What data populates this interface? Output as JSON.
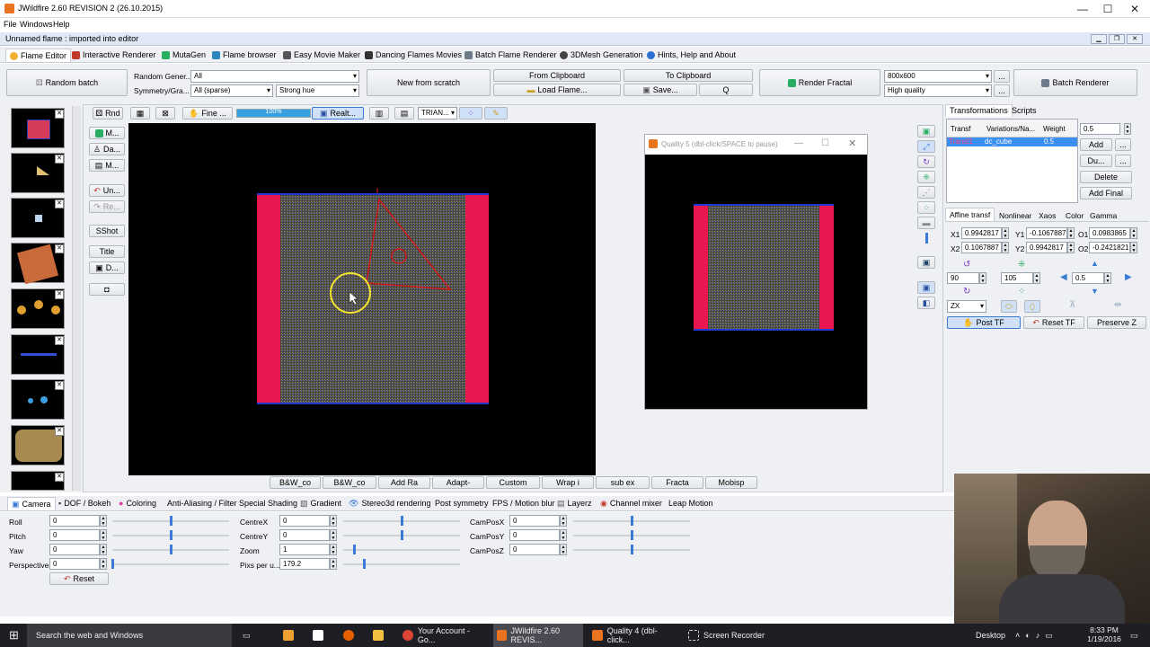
{
  "window": {
    "title": "JWildfire 2.60 REVISION 2 (26.10.2015)"
  },
  "menu": {
    "file": "File",
    "windows": "Windows",
    "help": "Help"
  },
  "inner": {
    "title": "Unnamed flame : imported into editor"
  },
  "tabs": [
    {
      "label": "Flame Editor",
      "icon": "flame-icon"
    },
    {
      "label": "Interactive Renderer",
      "icon": "renderer-icon"
    },
    {
      "label": "MutaGen",
      "icon": "mutagen-icon"
    },
    {
      "label": "Flame browser",
      "icon": "browser-icon"
    },
    {
      "label": "Easy Movie Maker",
      "icon": "movie-icon"
    },
    {
      "label": "Dancing Flames Movies",
      "icon": "dance-icon"
    },
    {
      "label": "Batch Flame Renderer",
      "icon": "batch-icon"
    },
    {
      "label": "3DMesh Generation",
      "icon": "mesh-icon"
    },
    {
      "label": "Hints, Help and About",
      "icon": "help-icon"
    }
  ],
  "toolbar": {
    "random_batch": "Random batch",
    "random_gen_label": "Random Gener...",
    "random_gen_value": "All",
    "symmetry_label": "Symmetry/Gra...",
    "symmetry_value": "All (sparse)",
    "gradient_value": "Strong hue",
    "new_from_scratch": "New from scratch",
    "from_clipboard": "From Clipboard",
    "to_clipboard": "To Clipboard",
    "load_flame": "Load Flame...",
    "save": "Save...",
    "q": "Q",
    "render_fractal": "Render Fractal",
    "resolution": "800x600",
    "quality": "High quality",
    "more": "...",
    "batch_renderer": "Batch Renderer"
  },
  "editor_toolbar": {
    "rnd": "Rnd",
    "fine": "Fine ...",
    "progress": "100%",
    "progress_value": 1.0,
    "realtime": "Realt...",
    "trian": "TRIAN..."
  },
  "side_buttons": [
    "M...",
    "Da...",
    "M...",
    "Un...",
    "Re...",
    "SShot",
    "Title",
    "D..."
  ],
  "bottom_buttons": [
    "B&W_co",
    "B&W_co",
    "Add Ra",
    "Adapt-",
    "Custom",
    "Wrap i",
    "sub ex",
    "Fracta",
    "Mobisp"
  ],
  "preview_window": {
    "title": "Quality 5 (dbl-click/SPACE to pause)"
  },
  "right_panel": {
    "tabs": [
      "Transformations",
      "Scripts"
    ],
    "table_headers": [
      "Transf",
      "Variations/Na...",
      "Weight"
    ],
    "row": {
      "transf": "Transf1",
      "variation": "dc_cube",
      "weight": "0.5"
    },
    "weight_field": "0.5",
    "add": "Add",
    "dup": "Du...",
    "delete": "Delete",
    "add_final": "Add Final",
    "dots1": "...",
    "dots2": "...",
    "sub_tabs": [
      "Affine transf",
      "Nonlinear",
      "Xaos",
      "Color",
      "Gamma"
    ],
    "x1_label": "X1",
    "x1": "0.9942817",
    "y1_label": "Y1",
    "y1": "-0.1067887",
    "o1_label": "O1",
    "o1": "0.0983865",
    "x2_label": "X2",
    "x2": "0.1067887",
    "y2_label": "Y2",
    "y2": "0.9942817",
    "o2_label": "O2",
    "o2": "-0.2421821",
    "rotate": "90",
    "scale": "105",
    "move": "0.5",
    "plane": "ZX",
    "post_tf": "Post TF",
    "reset_tf": "Reset TF",
    "preserve_z": "Preserve Z"
  },
  "bottom_tabs": [
    "Camera",
    "DOF / Bokeh",
    "Coloring",
    "Anti-Aliasing / Filter",
    "Special Shading",
    "Gradient",
    "Stereo3d rendering",
    "Post symmetry",
    "FPS / Motion blur",
    "Layerz",
    "Channel mixer",
    "Leap Motion"
  ],
  "camera": {
    "roll_label": "Roll",
    "roll": "0",
    "pitch_label": "Pitch",
    "pitch": "0",
    "yaw_label": "Yaw",
    "yaw": "0",
    "perspective_label": "Perspective",
    "perspective": "0",
    "reset": "Reset",
    "centrex_label": "CentreX",
    "centrex": "0",
    "centrey_label": "CentreY",
    "centrey": "0",
    "zoom_label": "Zoom",
    "zoom": "1",
    "pixs_label": "Pixs per u...",
    "pixs": "179.2",
    "camposx_label": "CamPosX",
    "camposx": "0",
    "camposy_label": "CamPosY",
    "camposy": "0",
    "camposz_label": "CamPosZ",
    "camposz": "0"
  },
  "taskbar": {
    "search": "Search the web and Windows",
    "apps": [
      "Your Account - Go...",
      "JWildfire 2.60 REVIS...",
      "Quality 4 (dbl-click...",
      "Screen Recorder"
    ],
    "desktop": "Desktop",
    "time": "8:33 PM",
    "date": "1/19/2016"
  },
  "colors": {
    "accent": "#3a7bd5",
    "flame_red": "#e8174f",
    "noise_yellow": "#b7b26a",
    "selection": "#3b8ff0"
  }
}
